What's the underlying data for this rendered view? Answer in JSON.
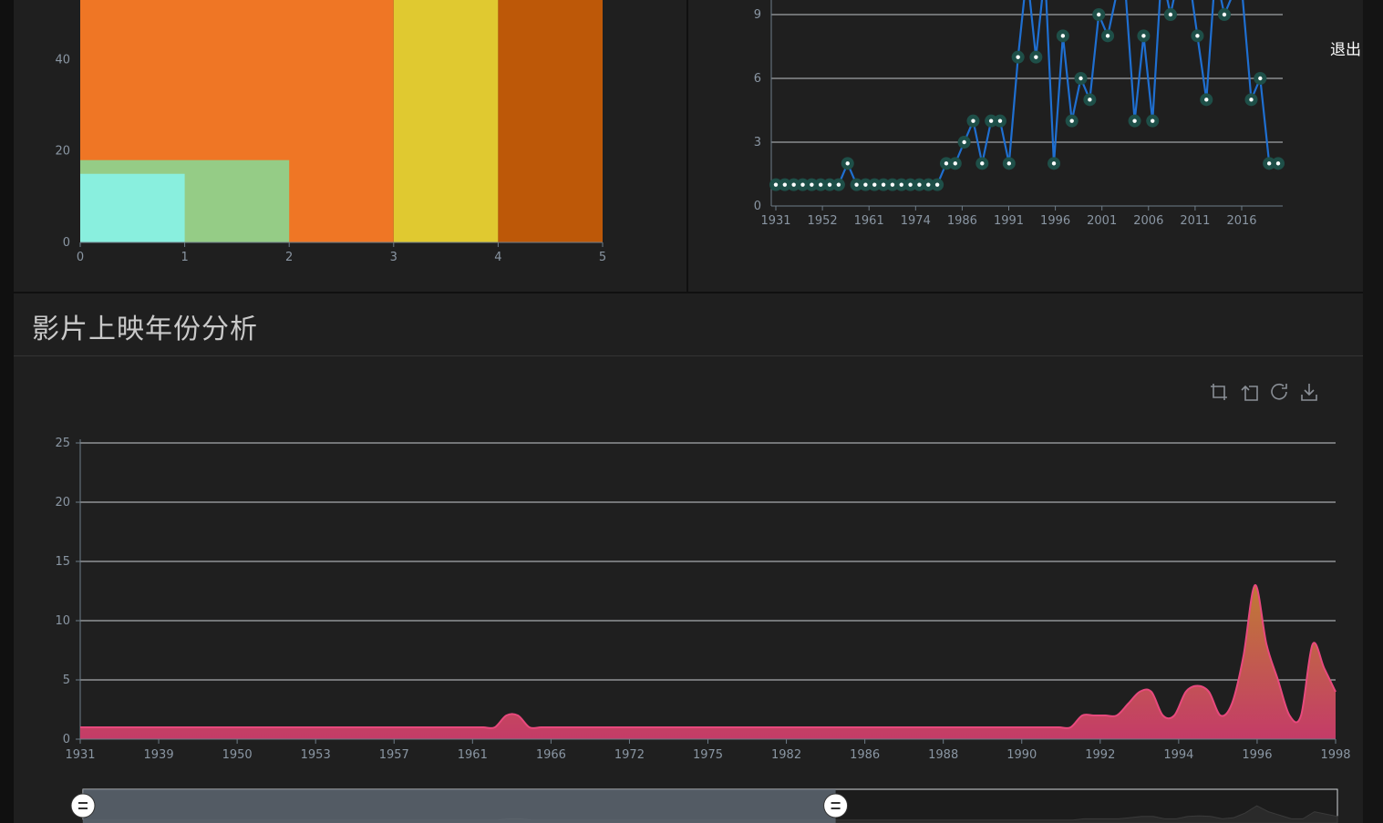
{
  "exit_label": "退出",
  "section_title": "影片上映年份分析",
  "toolbox": {
    "icons": [
      "crop-zoom-icon",
      "zoom-reset-icon",
      "restore-icon",
      "save-image-icon"
    ]
  },
  "colors": {
    "panel_bg": "#1f1f1f",
    "line_color": "#1f6fd1",
    "area_stroke": "#e8497d",
    "area_top": "#c07a35",
    "area_bottom": "#c43b68"
  },
  "chart_data": [
    {
      "type": "bar",
      "description_ticks_only": true,
      "x_ticks": [
        "0",
        "1",
        "2",
        "3",
        "4",
        "5"
      ],
      "y_ticks": [
        "0",
        "20",
        "40"
      ],
      "ylim": [
        0,
        55
      ],
      "bars": [
        {
          "x_start": 0,
          "x_end": 3,
          "value": 55,
          "color": "#ef7625"
        },
        {
          "x_start": 3,
          "x_end": 4,
          "value": 55,
          "color": "#e0c930"
        },
        {
          "x_start": 4,
          "x_end": 5,
          "value": 55,
          "color": "#bd5808"
        },
        {
          "x_start": 0,
          "x_end": 2,
          "value": 18,
          "color": "#95cc86"
        },
        {
          "x_start": 0,
          "x_end": 1,
          "value": 15,
          "color": "#89efde"
        }
      ]
    },
    {
      "type": "line",
      "x_ticks": [
        "1931",
        "1952",
        "1961",
        "1974",
        "1986",
        "1991",
        "1996",
        "2001",
        "2006",
        "2011",
        "2016"
      ],
      "y_ticks": [
        "0",
        "3",
        "6",
        "9"
      ],
      "ylim": [
        0,
        9.4
      ],
      "values": [
        1,
        1,
        1,
        1,
        1,
        1,
        1,
        1,
        2,
        1,
        1,
        1,
        1,
        1,
        1,
        1,
        1,
        1,
        1,
        2,
        2,
        3,
        4,
        2,
        4,
        4,
        2,
        7,
        11,
        7,
        11,
        2,
        8,
        4,
        6,
        5,
        9,
        8,
        10,
        10,
        4,
        8,
        4,
        11,
        9,
        11,
        11,
        8,
        5,
        11,
        9,
        10,
        10,
        5,
        6,
        2,
        2
      ]
    },
    {
      "type": "area",
      "title": "",
      "x_ticks": [
        "1931",
        "1939",
        "1950",
        "1953",
        "1957",
        "1961",
        "1966",
        "1972",
        "1975",
        "1982",
        "1986",
        "1988",
        "1990",
        "1992",
        "1994",
        "1996",
        "1998"
      ],
      "y_ticks": [
        "0",
        "5",
        "10",
        "15",
        "20",
        "25"
      ],
      "ylim": [
        0,
        25
      ],
      "values": [
        1,
        1,
        1,
        1,
        1,
        1,
        1,
        1,
        1,
        1,
        1,
        1,
        1,
        1,
        1,
        1,
        1,
        1,
        1,
        1,
        1,
        1,
        1,
        1,
        1,
        1,
        1,
        1,
        1,
        1,
        1,
        1,
        1,
        1,
        1,
        1,
        1,
        2,
        2,
        1,
        1,
        1,
        1,
        1,
        1,
        1,
        1,
        1,
        1,
        1,
        1,
        1,
        1,
        1,
        1,
        1,
        1,
        1,
        1,
        1,
        1,
        1,
        1,
        1,
        1,
        1,
        1,
        1,
        1,
        1,
        1,
        1,
        1,
        1,
        1,
        1,
        1,
        1,
        1,
        1,
        1,
        1,
        1,
        1,
        1,
        1,
        1,
        2,
        2,
        2,
        2,
        3,
        4,
        4,
        2,
        2,
        4,
        4.5,
        4,
        2,
        3,
        7,
        13,
        8,
        5,
        2,
        2,
        8,
        6,
        4
      ],
      "datazoom": {
        "start_percent": 0,
        "end_percent": 60
      }
    }
  ]
}
